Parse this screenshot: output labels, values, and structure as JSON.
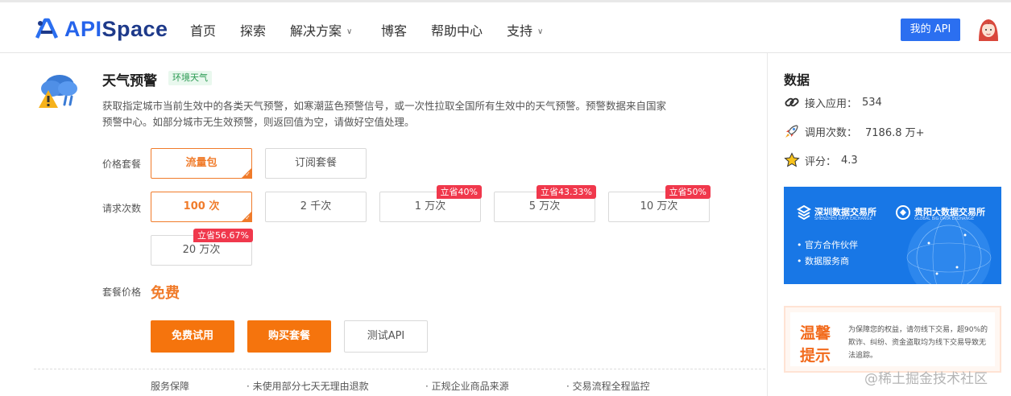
{
  "header": {
    "logo_text_a": "API",
    "logo_text_b": "Space",
    "nav": [
      {
        "label": "首页",
        "dropdown": false
      },
      {
        "label": "探索",
        "dropdown": false
      },
      {
        "label": "解决方案",
        "dropdown": true
      },
      {
        "label": "博客",
        "dropdown": false
      },
      {
        "label": "帮助中心",
        "dropdown": false
      },
      {
        "label": "支持",
        "dropdown": true
      }
    ],
    "my_api_label": "我的 API"
  },
  "product": {
    "title": "天气预警",
    "tag": "环境天气",
    "description": "获取指定城市当前生效中的各类天气预警，如寒潮蓝色预警信号，或一次性拉取全国所有生效中的天气预警。预警数据来自国家预警中心。如部分城市无生效预警，则返回值为空，请做好空值处理。"
  },
  "pricing": {
    "plan_label": "价格套餐",
    "plans": [
      {
        "label": "流量包",
        "active": true
      },
      {
        "label": "订阅套餐",
        "active": false
      }
    ],
    "count_label": "请求次数",
    "counts": [
      {
        "label": "100 次",
        "active": true,
        "discount": ""
      },
      {
        "label": "2 千次",
        "active": false,
        "discount": ""
      },
      {
        "label": "1 万次",
        "active": false,
        "discount": "立省40%"
      },
      {
        "label": "5 万次",
        "active": false,
        "discount": "立省43.33%"
      },
      {
        "label": "10 万次",
        "active": false,
        "discount": "立省50%"
      },
      {
        "label": "20 万次",
        "active": false,
        "discount": "立省56.67%"
      }
    ],
    "price_label": "套餐价格",
    "price_value": "免费"
  },
  "actions": {
    "trial": "免费试用",
    "buy": "购买套餐",
    "test": "测试API"
  },
  "guarantees": {
    "label": "服务保障",
    "items": [
      "未使用部分七天无理由退款",
      "正规企业商品来源",
      "交易流程全程监控"
    ]
  },
  "sidebar": {
    "title": "数据",
    "stats": [
      {
        "icon": "link-icon",
        "label": "接入应用：",
        "value": "534"
      },
      {
        "icon": "rocket-icon",
        "label": "调用次数：",
        "value": "7186.8 万+"
      },
      {
        "icon": "star-icon",
        "label": "评分：",
        "value": "4.3"
      }
    ],
    "banner": {
      "org1": "深圳数据交易所",
      "org1_sub": "SHENZHEN DATA EXCHANGE",
      "org2": "贵阳大数据交易所",
      "org2_sub": "GLOBAL BIG DATA EXCHANGE",
      "line1": "官方合作伙伴",
      "line2": "数据服务商"
    },
    "warning": {
      "title": "温馨提示",
      "text": "为保障您的权益，请勿线下交易，超90%的欺诈、纠纷、资金盗取均为线下交易导致无法追踪。"
    }
  },
  "watermark": "@稀土掘金技术社区",
  "colors": {
    "accent": "#f5740d",
    "brand": "#2b6ff0",
    "discount": "#f0384c"
  }
}
